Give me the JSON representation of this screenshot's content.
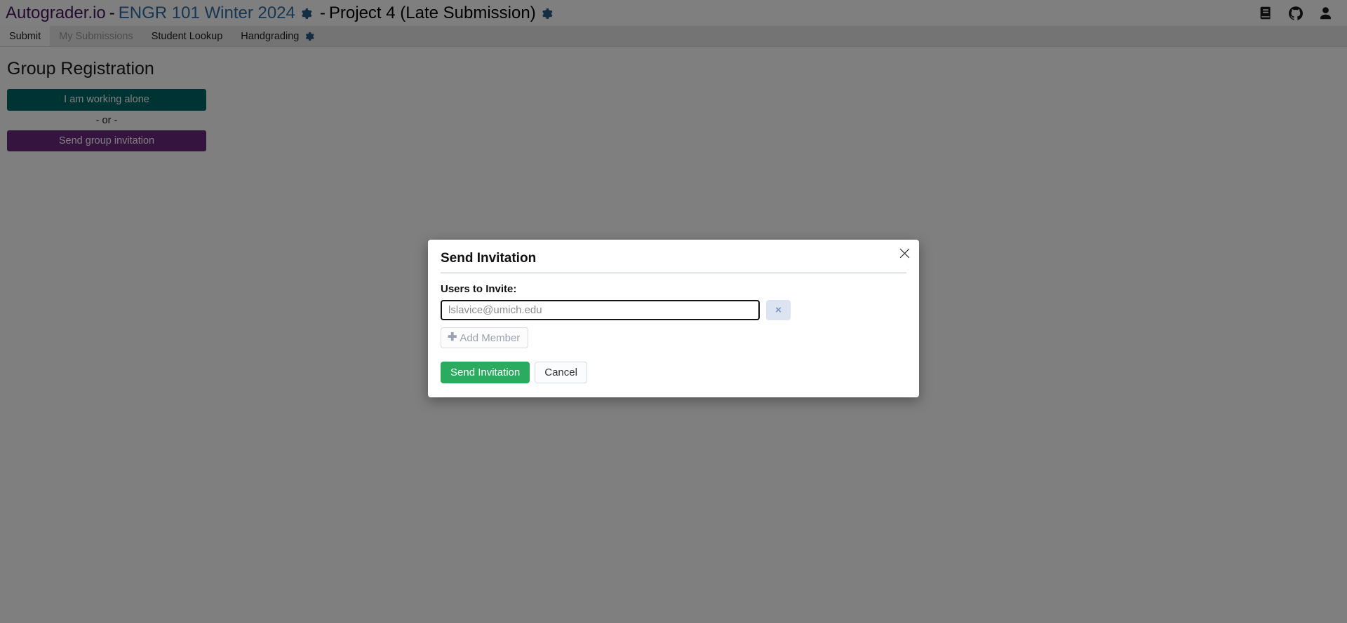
{
  "header": {
    "brand": "Autograder.io",
    "separator_1": "-",
    "course": "ENGR 101 Winter 2024",
    "separator_2": "-",
    "project": "Project 4 (Late Submission)",
    "course_gear_icon": "gear-icon",
    "project_gear_icon": "gear-icon",
    "icons": [
      {
        "name": "docs-book-icon",
        "label": "Documentation"
      },
      {
        "name": "github-icon",
        "label": "GitHub"
      },
      {
        "name": "user-account-icon",
        "label": "Account"
      }
    ],
    "colors": {
      "brand": "#46145e",
      "course": "#2e6da4",
      "gear": "#2a5b85"
    }
  },
  "nav": {
    "tabs": [
      {
        "label": "Submit",
        "state": "active"
      },
      {
        "label": "My Submissions",
        "state": "muted"
      },
      {
        "label": "Student Lookup",
        "state": "normal"
      },
      {
        "label": "Handgrading",
        "state": "normal",
        "gear_icon": "gear-icon"
      }
    ]
  },
  "main": {
    "title": "Group Registration",
    "working_alone_button": "I am working alone",
    "or_text": "- or -",
    "send_group_invitation_button": "Send group invitation",
    "colors": {
      "working_alone": "#006666",
      "send_group_invitation": "#6a2a80"
    }
  },
  "modal": {
    "title": "Send Invitation",
    "close_icon": "close-icon",
    "field_label": "Users to Invite:",
    "members": [
      {
        "value": "",
        "placeholder": "lslavice@umich.edu",
        "remove_label": "×",
        "remove_icon": "remove-x-icon"
      }
    ],
    "add_member_button": "Add Member",
    "add_member_icon": "plus-icon",
    "send_button": "Send Invitation",
    "cancel_button": "Cancel",
    "colors": {
      "send_button": "#2bab5f",
      "remove_button_bg": "#dce4f2",
      "remove_button_fg": "#7a92bd"
    }
  }
}
